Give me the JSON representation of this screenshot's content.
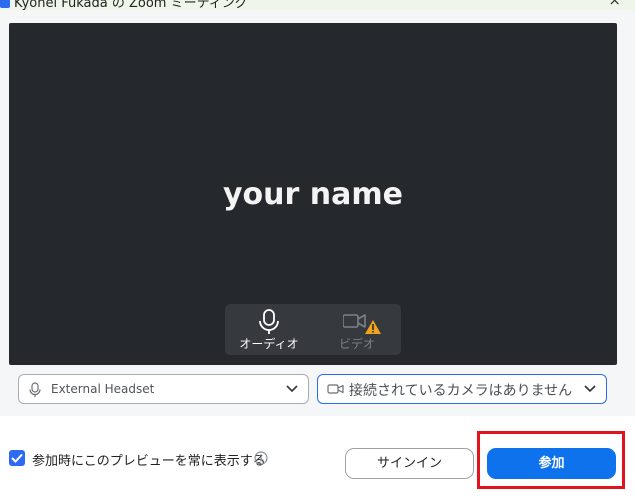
{
  "window": {
    "title": "Kyohei Fukada の Zoom ミーティング",
    "close_glyph": "×"
  },
  "preview": {
    "user_name": "your name",
    "audio_label": "オーディオ",
    "video_label": "ビデオ",
    "video_warning": true
  },
  "devices": {
    "audio_device": "External Headset",
    "video_device": "接続されているカメラはありません"
  },
  "footer": {
    "always_show_preview_label": "参加時にこのプレビューを常に表示する",
    "always_show_preview_checked": true,
    "signin_label": "サインイン",
    "join_label": "参加"
  },
  "colors": {
    "accent": "#0e72ed",
    "highlight": "#e1141d",
    "video_bg": "#25282d",
    "warning": "#f2a51a"
  },
  "icons": {
    "audio": "microphone-icon",
    "video": "camera-icon",
    "warning": "warning-icon",
    "chevron": "chevron-down-icon",
    "info": "info-icon",
    "check": "check-icon"
  }
}
